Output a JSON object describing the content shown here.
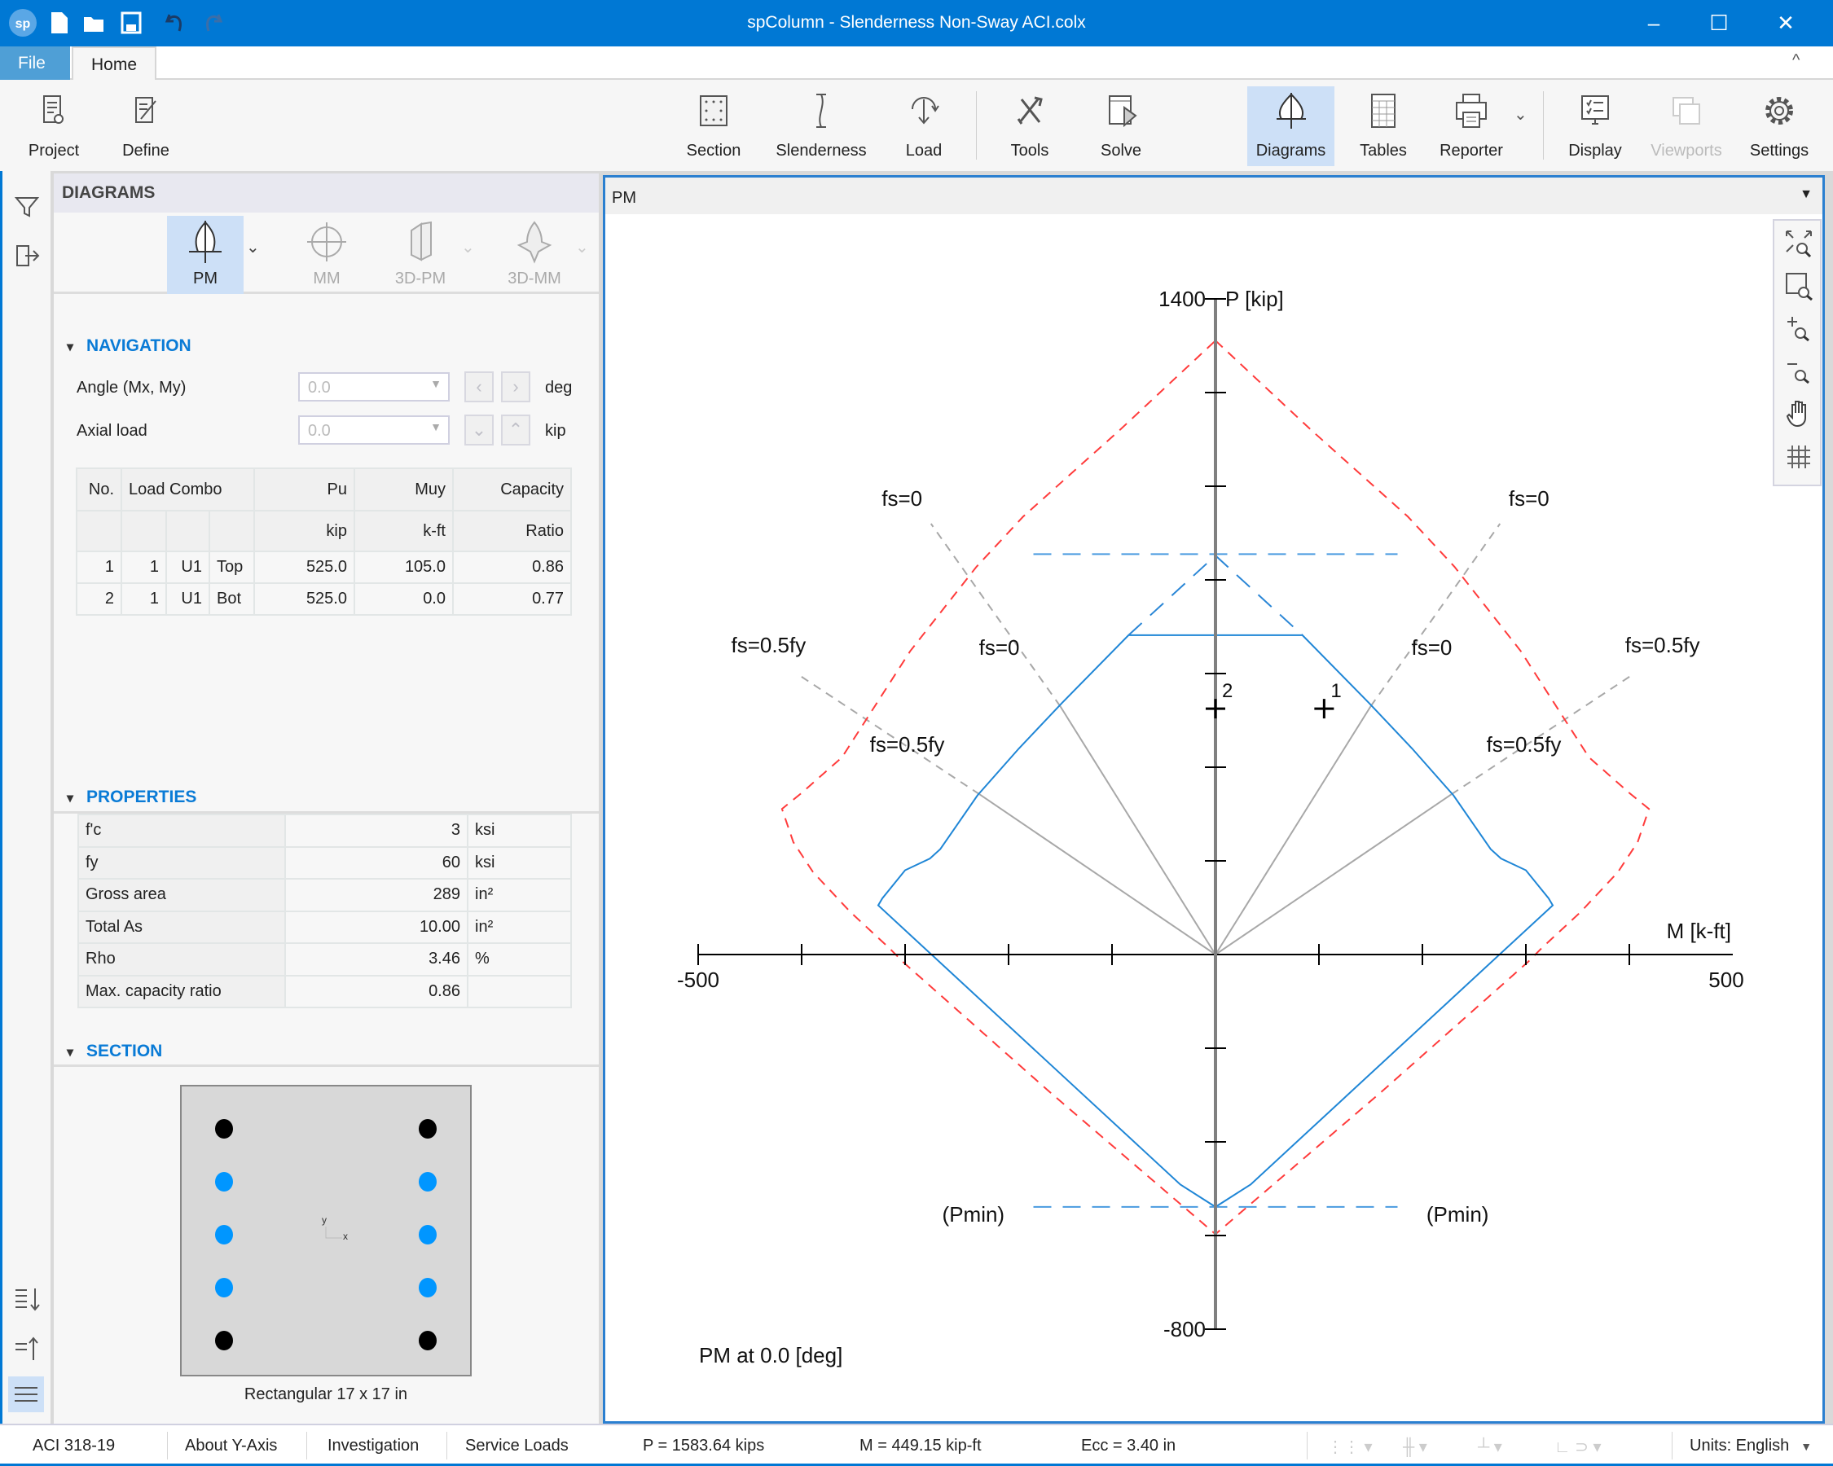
{
  "window": {
    "title": "spColumn - Slenderness Non-Sway ACI.colx",
    "logo": "sp",
    "controls": [
      "minimize-icon",
      "maximize-icon",
      "close-icon"
    ]
  },
  "quick_access": [
    "new-file-icon",
    "open-folder-icon",
    "save-icon",
    "undo-icon",
    "redo-icon"
  ],
  "tabs": [
    {
      "label": "File",
      "active": false
    },
    {
      "label": "Home",
      "active": true
    }
  ],
  "ribbon": {
    "items": [
      {
        "label": "Project",
        "icon": "project-icon"
      },
      {
        "label": "Define",
        "icon": "define-icon"
      },
      {
        "label": "Section",
        "icon": "section-icon"
      },
      {
        "label": "Slenderness",
        "icon": "slenderness-icon"
      },
      {
        "label": "Load",
        "icon": "load-icon"
      },
      {
        "label": "Tools",
        "icon": "tools-icon"
      },
      {
        "label": "Solve",
        "icon": "solve-icon"
      },
      {
        "label": "Diagrams",
        "icon": "diagrams-icon",
        "active": true
      },
      {
        "label": "Tables",
        "icon": "tables-icon"
      },
      {
        "label": "Reporter",
        "icon": "printer-icon"
      },
      {
        "label": "Display",
        "icon": "display-icon"
      },
      {
        "label": "Viewports",
        "icon": "viewports-icon",
        "disabled": true
      },
      {
        "label": "Settings",
        "icon": "gear-icon"
      }
    ]
  },
  "panel": {
    "title": "DIAGRAMS",
    "diagram_types": [
      {
        "label": "PM",
        "active": true
      },
      {
        "label": "MM",
        "disabled": true
      },
      {
        "label": "3D-PM",
        "disabled": true
      },
      {
        "label": "3D-MM",
        "disabled": true
      }
    ],
    "navigation": {
      "header": "NAVIGATION",
      "angle_label": "Angle (Mx, My)",
      "angle_value": "0.0",
      "angle_unit": "deg",
      "axial_label": "Axial load",
      "axial_value": "0.0",
      "axial_unit": "kip"
    },
    "loads_table": {
      "headers": [
        "No.",
        "Load Combo",
        "Pu",
        "Muy",
        "Capacity"
      ],
      "units": [
        "",
        "",
        "",
        "",
        "kip",
        "k-ft",
        "Ratio"
      ],
      "rows": [
        [
          "1",
          "1",
          "U1",
          "Top",
          "525.0",
          "105.0",
          "0.86"
        ],
        [
          "2",
          "1",
          "U1",
          "Bot",
          "525.0",
          "0.0",
          "0.77"
        ]
      ]
    },
    "properties": {
      "header": "PROPERTIES",
      "rows": [
        [
          "f'c",
          "3",
          "ksi"
        ],
        [
          "fy",
          "60",
          "ksi"
        ],
        [
          "Gross area",
          "289",
          "in²"
        ],
        [
          "Total As",
          "10.00",
          "in²"
        ],
        [
          "Rho",
          "3.46",
          "%"
        ],
        [
          "Max. capacity ratio",
          "0.86",
          ""
        ]
      ]
    },
    "section": {
      "header": "SECTION",
      "caption": "Rectangular 17 x 17 in",
      "axis_x": "x",
      "axis_y": "y",
      "bar_colors": {
        "corner": "#000000",
        "side": "#0096ff"
      }
    }
  },
  "chart_header": "PM",
  "chart_tools": [
    "zoom-extents-icon",
    "zoom-window-icon",
    "zoom-in-icon",
    "zoom-out-icon",
    "pan-hand-icon",
    "grid-icon"
  ],
  "chart_data": {
    "type": "line",
    "xlabel": "M [k-ft]",
    "ylabel": "P [kip]",
    "xlim": [
      -500,
      500
    ],
    "ylim": [
      -800,
      1400
    ],
    "x_tick_step": 100,
    "y_tick_step": 200,
    "tick_labels": {
      "xmin": "-500",
      "xmax": "500",
      "ymax": "1400",
      "ymin": "-800"
    },
    "annotation": "PM at 0.0 [deg]",
    "series": [
      {
        "role": "nominal",
        "style": "dashed",
        "color": "#ff3b3b",
        "points": [
          [
            0,
            1311
          ],
          [
            92,
            1121
          ],
          [
            186,
            935
          ],
          [
            231,
            828
          ],
          [
            295,
            648
          ],
          [
            361,
            421
          ],
          [
            400,
            345
          ],
          [
            419,
            311
          ],
          [
            408,
            240
          ],
          [
            389,
            176
          ],
          [
            353,
            91
          ],
          [
            315,
            13
          ],
          [
            302,
            -16
          ],
          [
            161,
            -292
          ],
          [
            0,
            -597
          ],
          [
            -161,
            -292
          ],
          [
            -302,
            -16
          ],
          [
            -315,
            13
          ],
          [
            -353,
            91
          ],
          [
            -389,
            176
          ],
          [
            -408,
            240
          ],
          [
            -419,
            311
          ],
          [
            -400,
            345
          ],
          [
            -361,
            421
          ],
          [
            -295,
            648
          ],
          [
            -231,
            828
          ],
          [
            -186,
            935
          ],
          [
            -92,
            1121
          ],
          [
            0,
            1311
          ]
        ]
      },
      {
        "role": "design",
        "style": "solid",
        "color": "#1f86d6",
        "points": [
          [
            0,
            682
          ],
          [
            84,
            682
          ],
          [
            148,
            538
          ],
          [
            190,
            440
          ],
          [
            230,
            340
          ],
          [
            266,
            225
          ],
          [
            276,
            205
          ],
          [
            300,
            180
          ],
          [
            322,
            120
          ],
          [
            326,
            105
          ],
          [
            34,
            -491
          ],
          [
            0,
            -539
          ],
          [
            -34,
            -491
          ],
          [
            -326,
            105
          ],
          [
            -322,
            120
          ],
          [
            -300,
            180
          ],
          [
            -276,
            205
          ],
          [
            -266,
            225
          ],
          [
            -230,
            340
          ],
          [
            -190,
            440
          ],
          [
            -148,
            538
          ],
          [
            -84,
            682
          ],
          [
            0,
            682
          ]
        ]
      },
      {
        "role": "max-axial",
        "style": "dashed",
        "color": "#4a9be0",
        "points": [
          [
            -176,
            855
          ],
          [
            176,
            855
          ]
        ]
      },
      {
        "role": "design-top",
        "style": "dashed",
        "color": "#2a86d6",
        "points": [
          [
            -84,
            682
          ],
          [
            0,
            852
          ],
          [
            84,
            682
          ]
        ]
      },
      {
        "role": "pmin",
        "style": "dashed",
        "color": "#4a9be0",
        "points": [
          [
            -176,
            -539
          ],
          [
            176,
            -539
          ]
        ]
      }
    ],
    "strain_lines": [
      {
        "label": "fs=0",
        "color": "#a8a8a8",
        "inner_end": [
          150,
          530
        ],
        "outer_end": [
          275,
          920
        ]
      },
      {
        "label": "fs=0",
        "color": "#a8a8a8",
        "inner_end": [
          -150,
          530
        ],
        "outer_end": [
          -275,
          920
        ]
      },
      {
        "label": "fs=0.5fy",
        "color": "#a8a8a8",
        "inner_end": [
          228,
          342
        ],
        "outer_end": [
          402,
          596
        ]
      },
      {
        "label": "fs=0.5fy",
        "color": "#a8a8a8",
        "inner_end": [
          -228,
          342
        ],
        "outer_end": [
          -402,
          596
        ]
      }
    ],
    "labels": {
      "fs0": "fs=0",
      "fs05": "fs=0.5fy",
      "pmin": "(Pmin)"
    },
    "load_points": [
      {
        "label": "1",
        "M": 105,
        "P": 525
      },
      {
        "label": "2",
        "M": 0,
        "P": 525
      }
    ]
  },
  "status": {
    "code": "ACI 318-19",
    "axis": "About Y-Axis",
    "mode": "Investigation",
    "loads": "Service Loads",
    "p": "P = 1583.64 kips",
    "m": "M = 449.15 kip-ft",
    "ecc": "Ecc = 3.40 in",
    "units": "Units:  English"
  },
  "colors": {
    "accent": "#0078d4",
    "active_bg": "#cde0f7",
    "section_accent": "#0a7bd6"
  }
}
